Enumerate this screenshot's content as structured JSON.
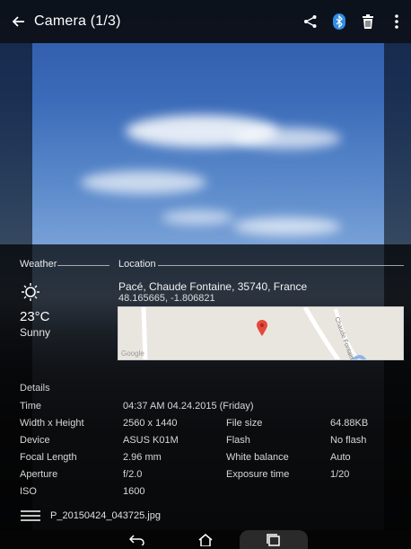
{
  "app_bar": {
    "title": "Camera (1/3)",
    "icons": [
      "back-icon",
      "share-icon",
      "bluetooth-icon",
      "delete-icon",
      "more-icon"
    ]
  },
  "weather": {
    "section_label": "Weather",
    "icon": "sun-icon",
    "temperature": "23°C",
    "condition": "Sunny"
  },
  "location": {
    "section_label": "Location",
    "address": "Pacé, Chaude Fontaine, 35740, France",
    "coordinates": "48.165665, -1.806821",
    "map_brand": "Google",
    "map_street": "Chaude Fontaine"
  },
  "details": {
    "section_label": "Details",
    "rows": [
      {
        "label": "Time",
        "value": "04:37 AM 04.24.2015 (Friday)"
      },
      {
        "label": "Width x Height",
        "value": "2560 x 1440",
        "label2": "File size",
        "value2": "64.88KB"
      },
      {
        "label": "Device",
        "value": "ASUS K01M",
        "label2": "Flash",
        "value2": "No flash"
      },
      {
        "label": "Focal Length",
        "value": "2.96 mm",
        "label2": "White balance",
        "value2": "Auto"
      },
      {
        "label": "Aperture",
        "value": "f/2.0",
        "label2": "Exposure time",
        "value2": "1/20"
      },
      {
        "label": "ISO",
        "value": "1600"
      }
    ]
  },
  "file": {
    "name": "P_20150424_043725.jpg"
  },
  "colors": {
    "pin": "#e5483c",
    "map_bg": "#e9e6df",
    "bluetooth": "#2f8de4"
  },
  "navbar": {
    "icons": [
      "back-nav-icon",
      "home-icon",
      "recent-apps-icon"
    ]
  }
}
